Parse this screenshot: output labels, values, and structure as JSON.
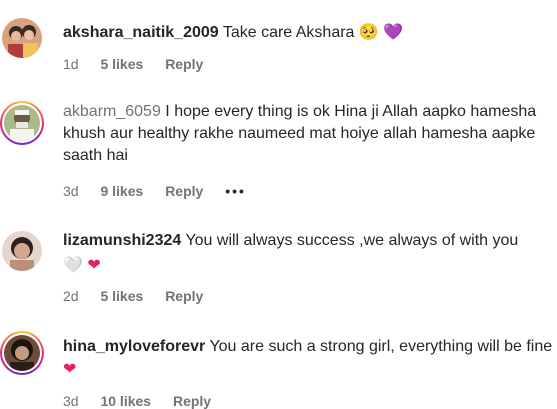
{
  "comments": [
    {
      "username": "akshara_naitik_2009",
      "text": "Take care Akshara",
      "emojis": "🥺 💜",
      "time": "1d",
      "likes": "5 likes",
      "reply": "Reply",
      "avatar_colors": [
        "#c98a6a",
        "#3b2a22",
        "#e8b8a0"
      ]
    },
    {
      "username": "akbarm_6059",
      "text": "I hope every thing is ok Hina ji Allah aapko hamesha khush aur healthy rakhe naumeed mat hoiye allah hamesha aapke saath hai",
      "time": "3d",
      "likes": "9 likes",
      "reply": "Reply",
      "more": "•••",
      "avatar_colors": [
        "#9ab07a",
        "#f4f4f0",
        "#6b5a48"
      ]
    },
    {
      "username": "lizamunshi2324",
      "text": "You will always success ,we always of with you",
      "emojis": "🤍 ❤️",
      "time": "2d",
      "likes": "5 likes",
      "reply": "Reply",
      "avatar_colors": [
        "#d9c2b5",
        "#2e211b",
        "#c89a86"
      ]
    },
    {
      "username": "hina_myloveforevr",
      "text": "You are such a strong girl, everything will be fine",
      "emojis": "❤️",
      "time": "3d",
      "likes": "10 likes",
      "reply": "Reply",
      "avatar_colors": [
        "#6e4a3a",
        "#1c1411",
        "#c49a80"
      ]
    }
  ]
}
